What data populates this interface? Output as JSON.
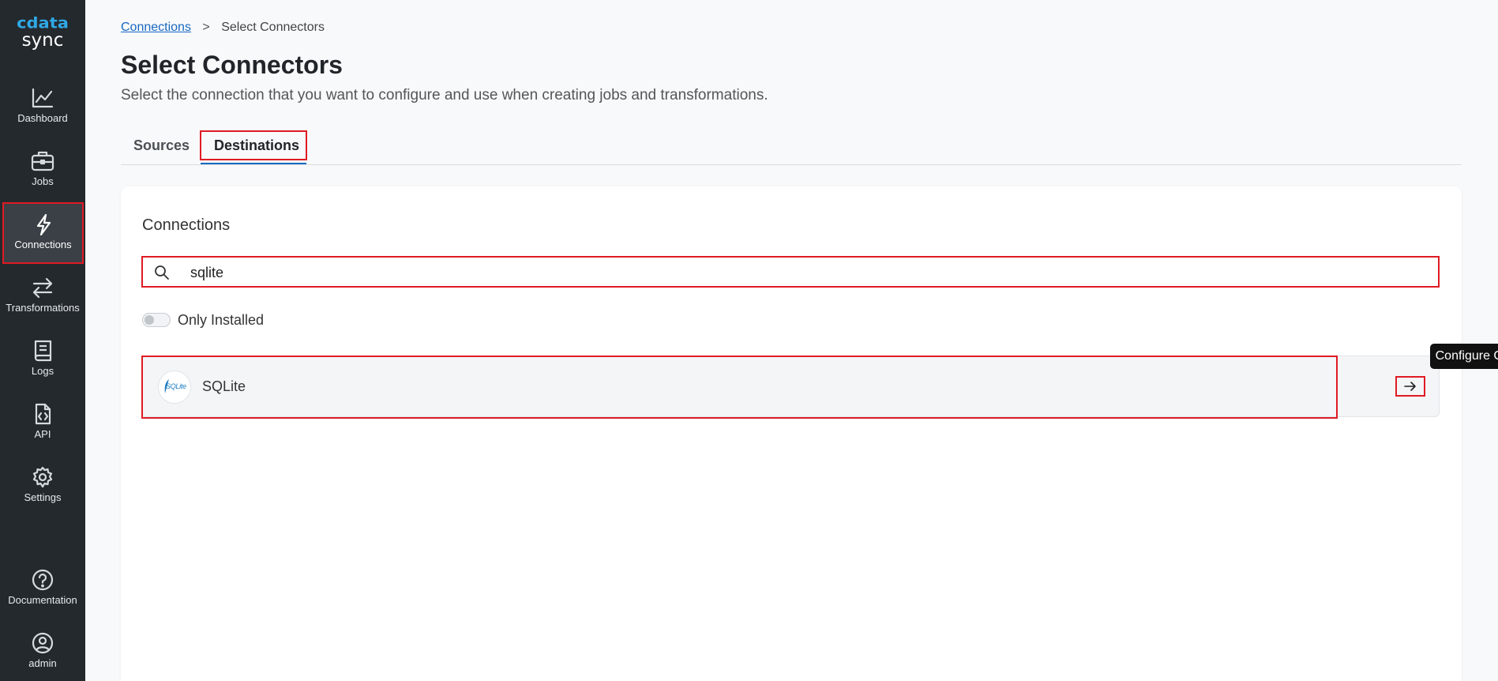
{
  "sidebar": {
    "logo": {
      "brand": "cdata",
      "product": "sync"
    },
    "items": [
      {
        "label": "Dashboard"
      },
      {
        "label": "Jobs"
      },
      {
        "label": "Connections"
      },
      {
        "label": "Transformations"
      },
      {
        "label": "Logs"
      },
      {
        "label": "API"
      },
      {
        "label": "Settings"
      }
    ],
    "bottom_items": [
      {
        "label": "Documentation"
      },
      {
        "label": "admin"
      }
    ]
  },
  "breadcrumb": {
    "parent": "Connections",
    "separator": ">",
    "current": "Select Connectors"
  },
  "page": {
    "title": "Select Connectors",
    "subtitle": "Select the connection that you want to configure and use when creating jobs and transformations."
  },
  "tabs": [
    {
      "label": "Sources"
    },
    {
      "label": "Destinations",
      "active": true
    }
  ],
  "card": {
    "title": "Connections",
    "search": {
      "value": "sqlite"
    },
    "toggle": {
      "label": "Only Installed",
      "on": false
    },
    "results": [
      {
        "name": "SQLite",
        "logo_text": "SQLite"
      }
    ],
    "tooltip": "Configure Connection"
  },
  "colors": {
    "sidebar_bg": "#24292e",
    "accent_blue": "#1769c2",
    "logo_blue": "#2fa9e6",
    "highlight_red": "#e01b24"
  }
}
